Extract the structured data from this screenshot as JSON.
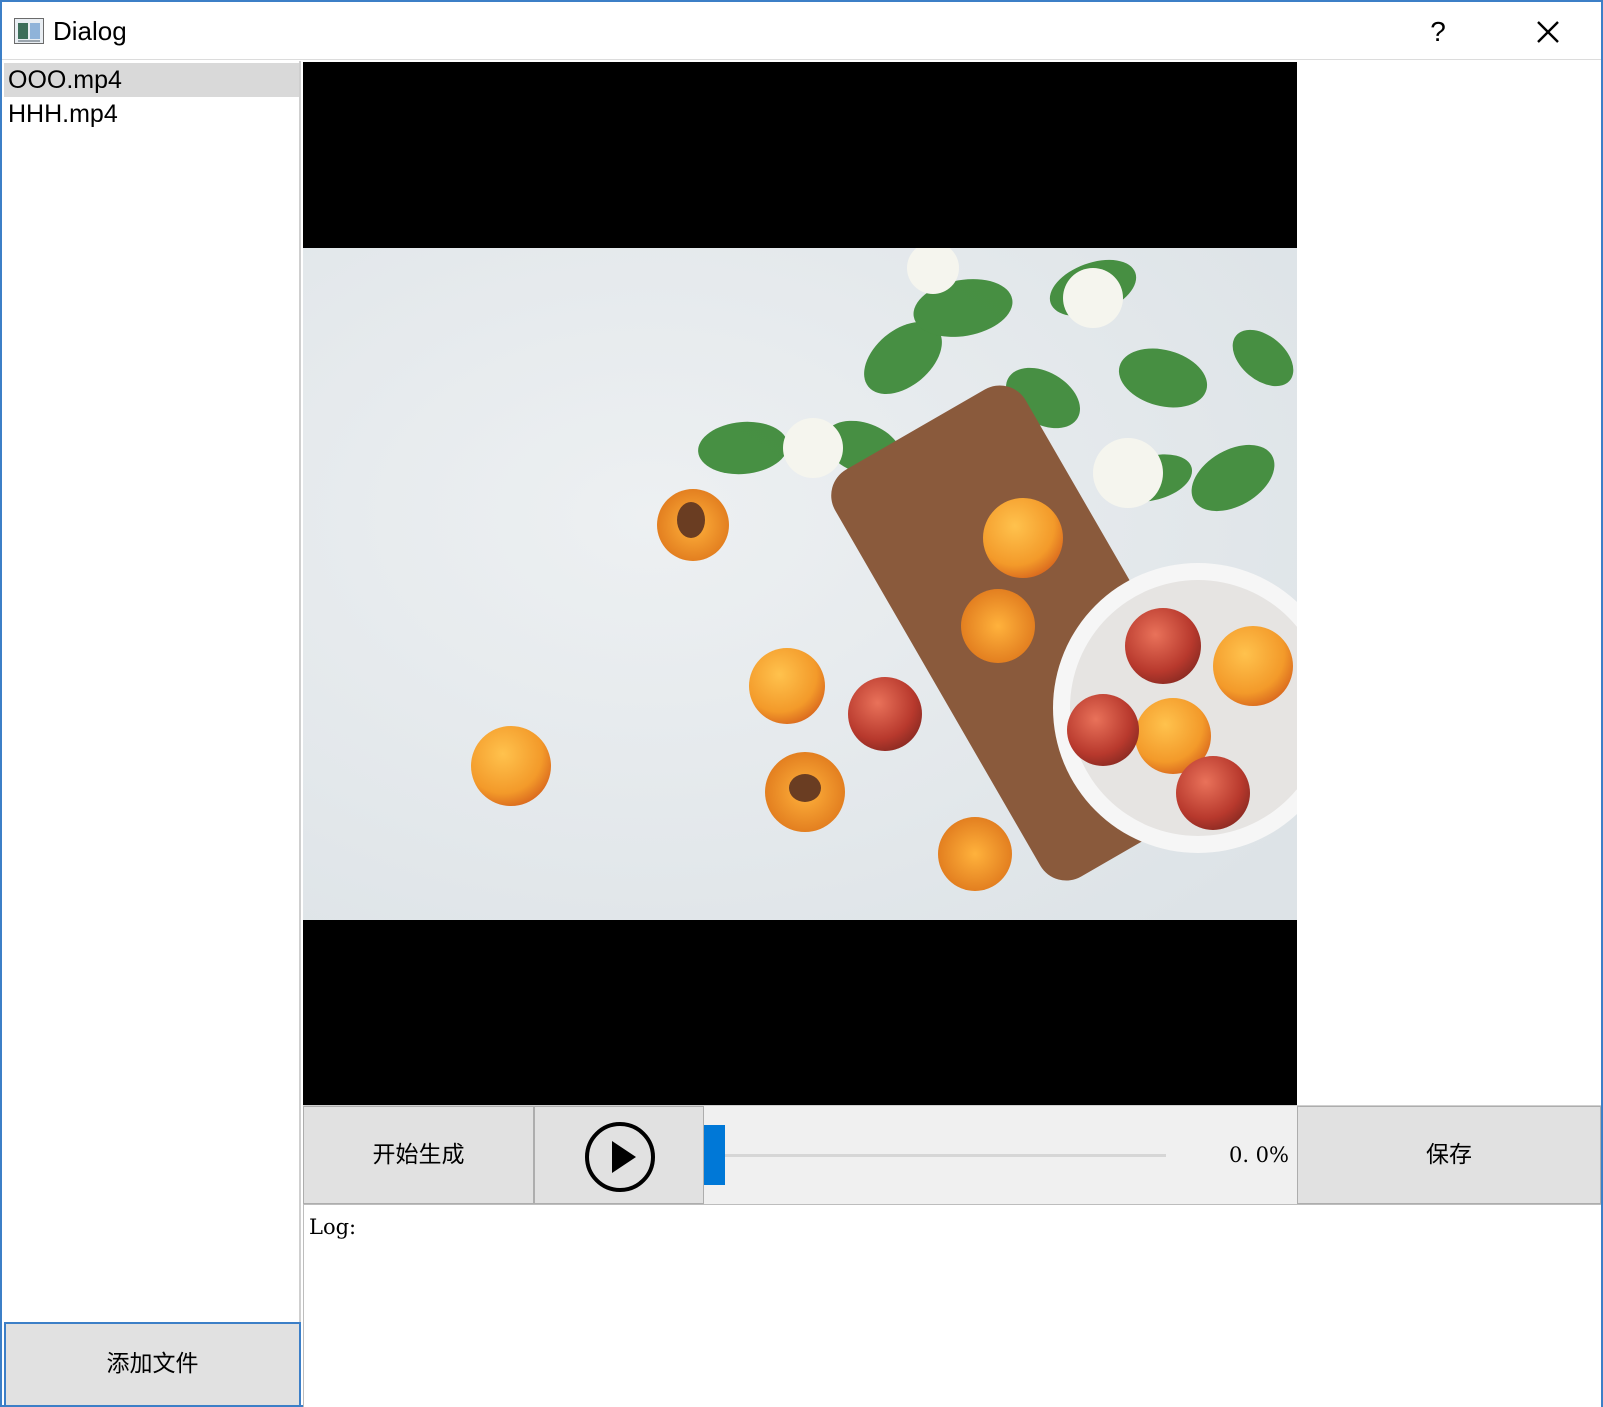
{
  "window": {
    "title": "Dialog",
    "help_label": "?",
    "icon": "app-window-icon",
    "close_icon": "close-icon"
  },
  "file_list": {
    "items": [
      {
        "label": "OOO.mp4",
        "selected": true
      },
      {
        "label": "HHH.mp4",
        "selected": false
      }
    ],
    "add_button_label": "添加文件"
  },
  "video": {
    "frame_description_icon": "video-frame"
  },
  "controls": {
    "start_button_label": "开始生成",
    "play_icon": "play-icon",
    "progress_text": "0. 0%",
    "progress_fraction": 0.0,
    "save_button_label": "保存"
  },
  "log": {
    "text": "Log:"
  },
  "colors": {
    "accent": "#0078d7",
    "window_border": "#3c7fc7",
    "button_bg": "#e1e1e1",
    "selection_bg": "#d9d9d9"
  }
}
